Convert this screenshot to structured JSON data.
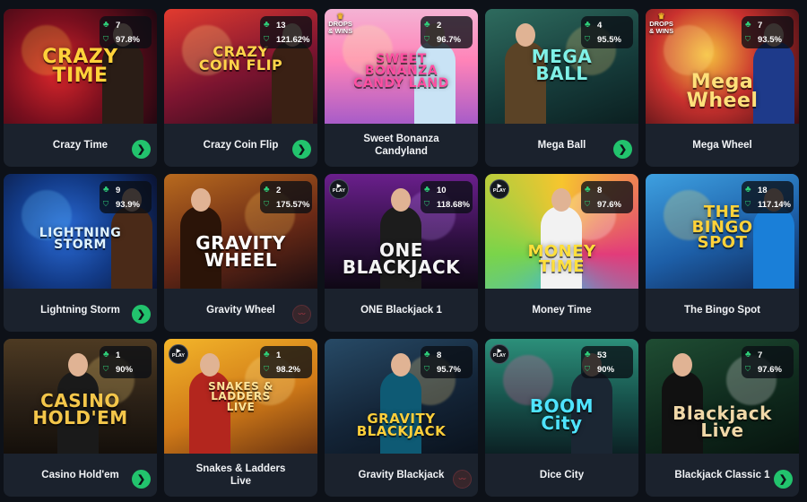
{
  "icons": {
    "stats_top": "people-icon",
    "stats_bottom": "rtp-icon",
    "arrow": "arrow-right-icon",
    "provider": "provider-logo-icon"
  },
  "colors": {
    "accent": "#22c36d",
    "card": "#1b222d",
    "background": "#0d1118"
  },
  "games": [
    {
      "title": "Crazy Time",
      "logo": "CRAZY\nTIME",
      "players": "7",
      "rtp": "97.8%",
      "badge": "",
      "end": "arrow"
    },
    {
      "title": "Crazy Coin Flip",
      "logo": "CRAZY\nCOIN FLIP",
      "players": "13",
      "rtp": "121.62%",
      "badge": "",
      "end": "arrow"
    },
    {
      "title": "Sweet Bonanza Candyland",
      "logo": "SWEET\nBONANZA\nCANDY LAND",
      "players": "2",
      "rtp": "96.7%",
      "badge": "DROPS\n& WINS",
      "end": ""
    },
    {
      "title": "Mega Ball",
      "logo": "MEGA\nBALL",
      "players": "4",
      "rtp": "95.5%",
      "badge": "",
      "end": "arrow"
    },
    {
      "title": "Mega Wheel",
      "logo": "Mega\nWheel",
      "players": "7",
      "rtp": "93.5%",
      "badge": "DROPS\n& WINS",
      "end": ""
    },
    {
      "title": "Lightning Storm",
      "logo": "LIGHTNING\nSTORM",
      "players": "9",
      "rtp": "93.9%",
      "badge": "",
      "end": "arrow"
    },
    {
      "title": "Gravity Wheel",
      "logo": "GRAVITY\nWHEEL",
      "players": "2",
      "rtp": "175.57%",
      "badge": "",
      "end": "provider"
    },
    {
      "title": "ONE Blackjack 1",
      "logo": "ONE\nBLACKJACK",
      "players": "10",
      "rtp": "118.68%",
      "badge": "PLAY",
      "end": ""
    },
    {
      "title": "Money Time",
      "logo": "MONEY\nTIME",
      "players": "8",
      "rtp": "97.6%",
      "badge": "PLAY",
      "end": ""
    },
    {
      "title": "The Bingo Spot",
      "logo": "THE\nBINGO\nSPOT",
      "players": "18",
      "rtp": "117.14%",
      "badge": "",
      "end": ""
    },
    {
      "title": "Casino Hold'em",
      "logo": "CASINO\nHOLD'EM",
      "players": "1",
      "rtp": "90%",
      "badge": "",
      "end": "arrow"
    },
    {
      "title": "Snakes & Ladders Live",
      "logo": "SNAKES &\nLADDERS\nLIVE",
      "players": "1",
      "rtp": "98.2%",
      "badge": "PLAY",
      "end": ""
    },
    {
      "title": "Gravity Blackjack",
      "logo": "GRAVITY\nBLACKJACK",
      "players": "8",
      "rtp": "95.7%",
      "badge": "",
      "end": "provider"
    },
    {
      "title": "Dice City",
      "logo": "BOOM\nCity",
      "players": "53",
      "rtp": "90%",
      "badge": "PLAY",
      "end": ""
    },
    {
      "title": "Blackjack Classic 1",
      "logo": "Blackjack\nLive",
      "players": "7",
      "rtp": "97.6%",
      "badge": "",
      "end": "arrow"
    }
  ]
}
